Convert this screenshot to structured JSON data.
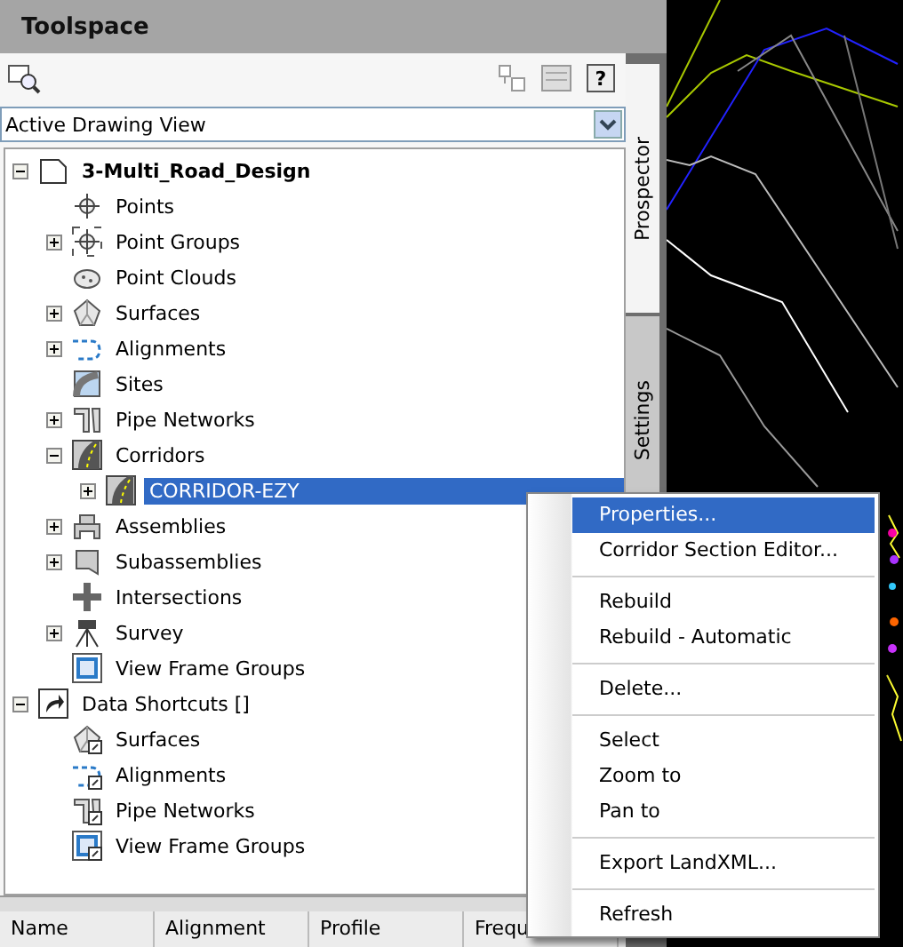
{
  "window": {
    "title": "Toolspace"
  },
  "help_button": {
    "label": "?"
  },
  "view_selector": {
    "value": "Active Drawing View"
  },
  "tree": [
    {
      "label": "3-Multi_Road_Design",
      "kind": "drawing",
      "expanded": true,
      "selected": false,
      "children": [
        {
          "label": "Points",
          "kind": "points",
          "selected": false
        },
        {
          "label": "Point Groups",
          "kind": "point-groups",
          "expanded": false,
          "selected": false
        },
        {
          "label": "Point Clouds",
          "kind": "cloud",
          "selected": false
        },
        {
          "label": "Surfaces",
          "kind": "surface",
          "expanded": false,
          "selected": false
        },
        {
          "label": "Alignments",
          "kind": "alignment",
          "expanded": false,
          "selected": false
        },
        {
          "label": "Sites",
          "kind": "site",
          "selected": false
        },
        {
          "label": "Pipe Networks",
          "kind": "pipe",
          "expanded": false,
          "selected": false
        },
        {
          "label": "Corridors",
          "kind": "corridor",
          "expanded": true,
          "selected": false,
          "children": [
            {
              "label": "CORRIDOR-EZY",
              "kind": "corridor",
              "expanded": false,
              "selected": true
            }
          ]
        },
        {
          "label": "Assemblies",
          "kind": "assembly",
          "expanded": false,
          "selected": false
        },
        {
          "label": "Subassemblies",
          "kind": "subassembly",
          "expanded": false,
          "selected": false
        },
        {
          "label": "Intersections",
          "kind": "intersection",
          "selected": false
        },
        {
          "label": "Survey",
          "kind": "survey",
          "expanded": false,
          "selected": false
        },
        {
          "label": "View Frame Groups",
          "kind": "viewframe",
          "selected": false
        }
      ]
    },
    {
      "label": "Data Shortcuts []",
      "kind": "shortcut",
      "expanded": true,
      "selected": false,
      "children": [
        {
          "label": "Surfaces",
          "kind": "surface",
          "shortcut": true,
          "selected": false
        },
        {
          "label": "Alignments",
          "kind": "alignment",
          "shortcut": true,
          "selected": false
        },
        {
          "label": "Pipe Networks",
          "kind": "pipe",
          "shortcut": true,
          "selected": false
        },
        {
          "label": "View Frame Groups",
          "kind": "viewframe",
          "shortcut": true,
          "selected": false
        }
      ]
    }
  ],
  "side_tabs": [
    {
      "label": "Prospector",
      "selected": true
    },
    {
      "label": "Settings",
      "selected": false
    }
  ],
  "list_columns": [
    "Name",
    "Alignment",
    "Profile",
    "Frequ"
  ],
  "context_menu": [
    [
      {
        "label": "Properties...",
        "selected": true
      },
      {
        "label": "Corridor Section Editor...",
        "selected": false
      }
    ],
    [
      {
        "label": "Rebuild",
        "selected": false
      },
      {
        "label": "Rebuild - Automatic",
        "selected": false
      }
    ],
    [
      {
        "label": "Delete...",
        "selected": false
      }
    ],
    [
      {
        "label": "Select",
        "selected": false
      },
      {
        "label": "Zoom to",
        "selected": false
      },
      {
        "label": "Pan to",
        "selected": false
      }
    ],
    [
      {
        "label": "Export LandXML...",
        "selected": false
      }
    ],
    [
      {
        "label": "Refresh",
        "selected": false
      }
    ]
  ]
}
